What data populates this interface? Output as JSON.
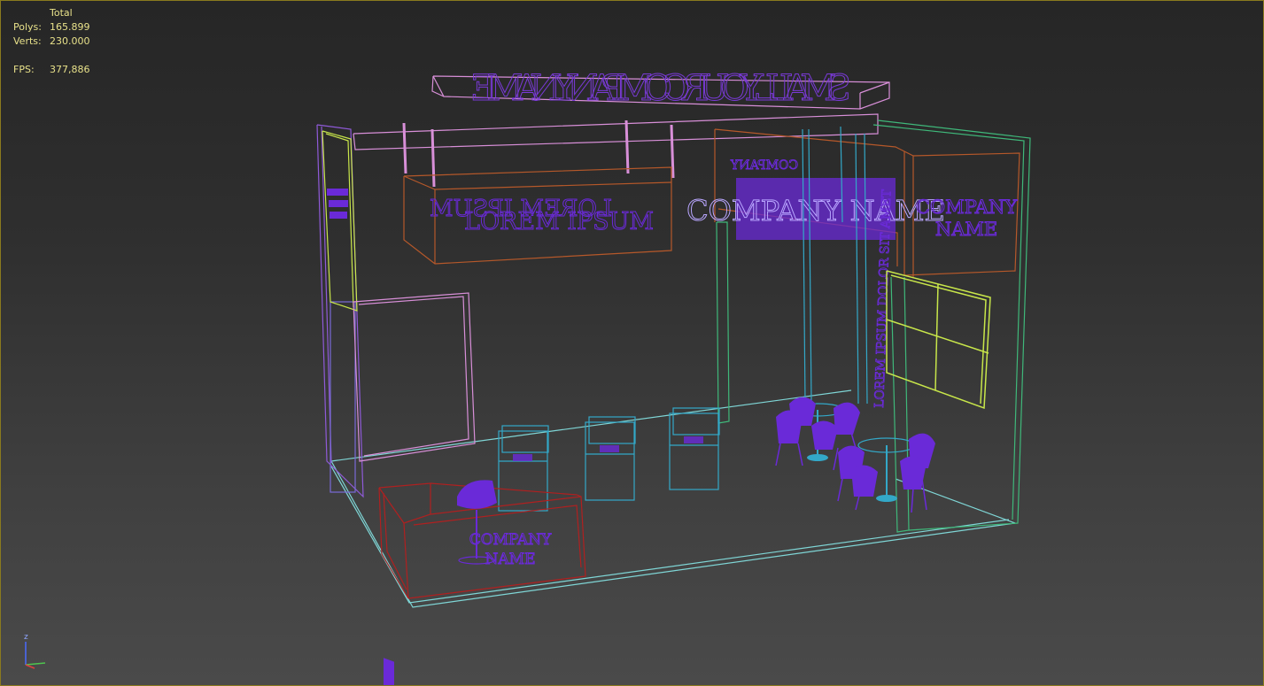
{
  "stats": {
    "header": "Total",
    "polys_label": "Polys:",
    "polys_value": "165.899",
    "verts_label": "Verts:",
    "verts_value": "230.000",
    "fps_label": "FPS:",
    "fps_value": "377,886"
  },
  "scene": {
    "top_sign_text": "SMALL YOUR COMPANY NAME",
    "banner_text_mirrored": "LOREM IPSUM",
    "banner_text": "LOREM IPSUM",
    "back_sign_small": "COMPANY",
    "back_sign_block": "COMPANY NAME",
    "right_wall_line1": "COMPANY",
    "right_wall_line2": "NAME",
    "column_vertical_text": "LOREM IPSUM DOLOR SIT AMET",
    "desk_line1": "COMPANY",
    "desk_line2": "NAME"
  },
  "gizmo": {
    "z_label": "z"
  },
  "colors": {
    "stats_text": "#e8e18a",
    "wire_pink": "#d88fd8",
    "wire_orange": "#b5582a",
    "wire_green": "#3fb87a",
    "wire_cyan": "#33a8c8",
    "wire_yellow": "#c8e64a",
    "wire_purple": "#6a2ad8",
    "wire_red": "#b02020",
    "floor_line": "#7fd6d6"
  }
}
